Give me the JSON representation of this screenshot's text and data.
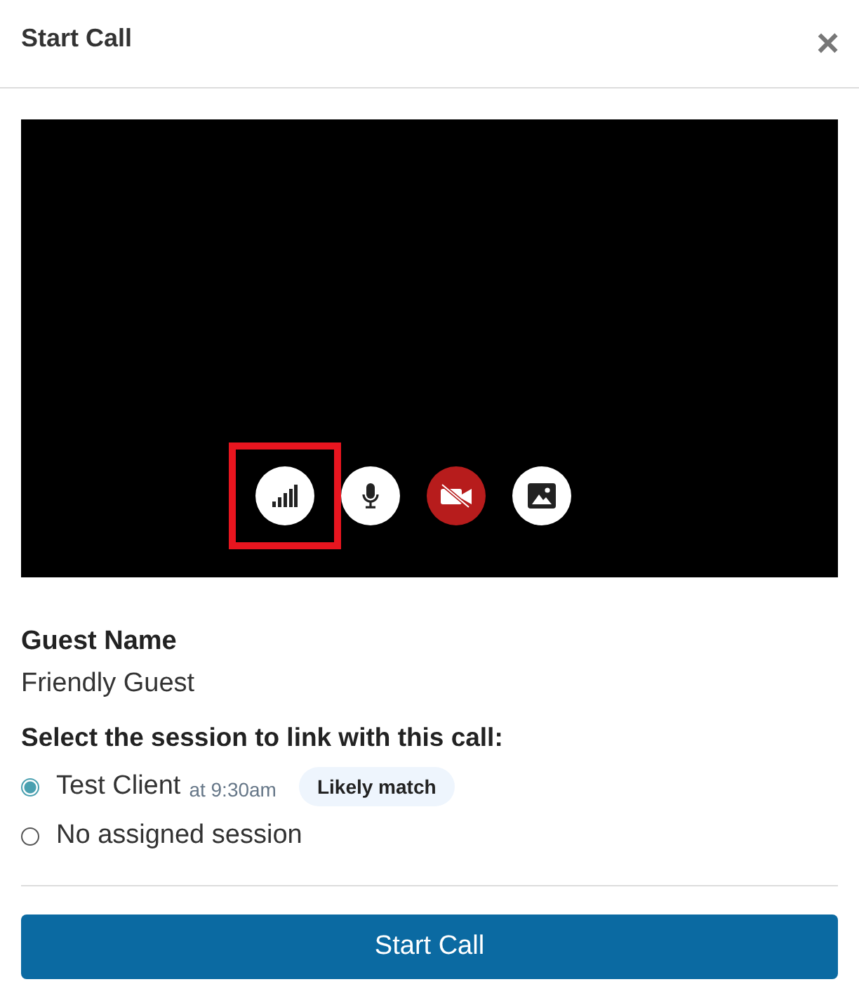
{
  "dialog": {
    "title": "Start Call",
    "close": "×"
  },
  "video": {
    "controls": [
      {
        "kind": "signal",
        "off": false,
        "highlighted": true
      },
      {
        "kind": "mic",
        "off": false,
        "highlighted": false
      },
      {
        "kind": "camera",
        "off": true,
        "highlighted": false
      },
      {
        "kind": "background",
        "off": false,
        "highlighted": false
      }
    ]
  },
  "guest": {
    "label": "Guest Name",
    "value": "Friendly Guest"
  },
  "session_prompt": "Select the session to link with this call:",
  "sessions": [
    {
      "name": "Test Client",
      "time": "at 9:30am",
      "badge": "Likely match",
      "selected": true
    },
    {
      "name": "No assigned session",
      "selected": false
    }
  ],
  "primary_button": "Start Call"
}
